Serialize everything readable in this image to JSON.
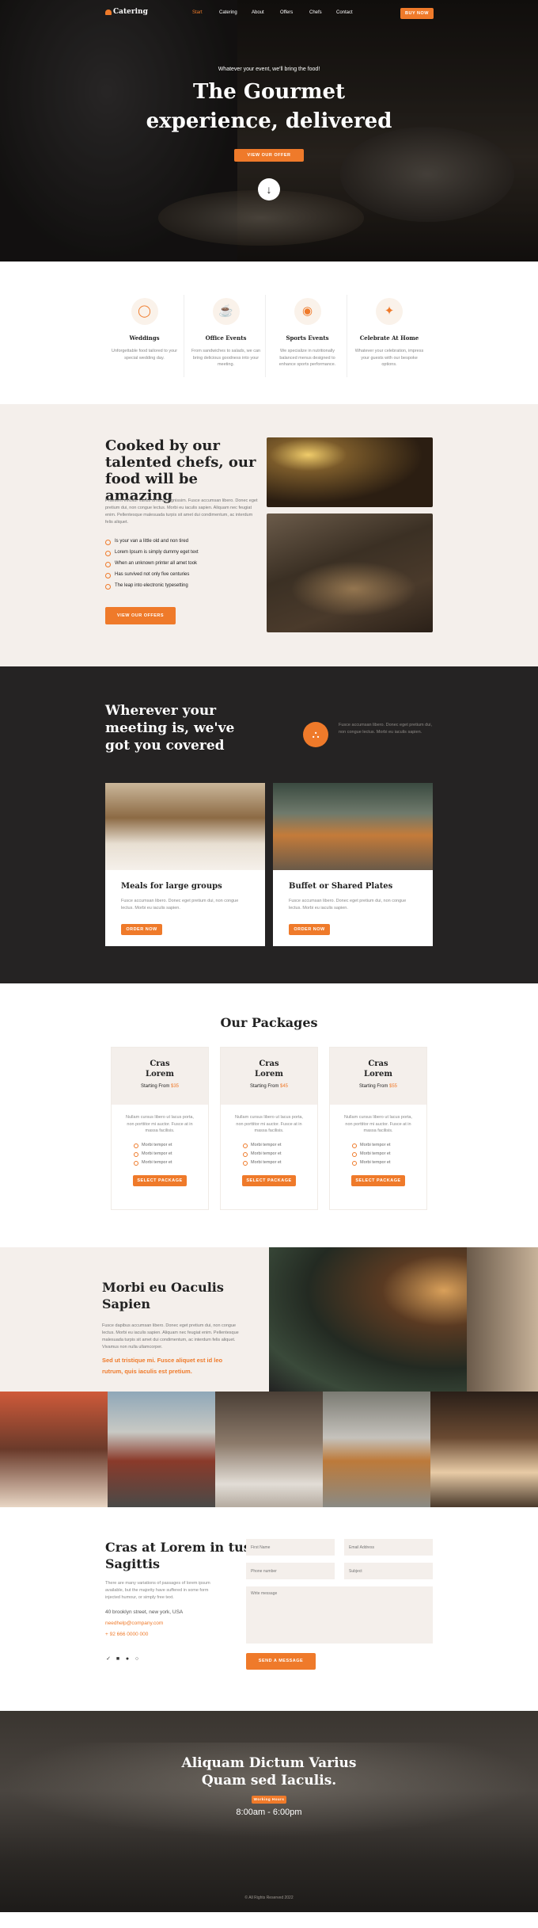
{
  "nav": {
    "logo": "Catering",
    "links": [
      "Start",
      "Catering",
      "About",
      "Offers",
      "Chefs",
      "Contact"
    ],
    "buy": "BUY NOW",
    "accent": "#ef7a2a"
  },
  "hero": {
    "subtitle": "Whatever your event, we'll bring the food!",
    "title_line1": "The Gourmet",
    "title_line2": "experience, delivered",
    "cta": "VIEW OUR OFFER"
  },
  "services": [
    {
      "icon": "ring-icon",
      "title": "Weddings",
      "text": "Unforgettable food tailored to your special wedding day."
    },
    {
      "icon": "cup-icon",
      "title": "Office Events",
      "text": "From sandwiches to salads, we can bring delicious goodness into your meeting."
    },
    {
      "icon": "helmet-icon",
      "title": "Sports Events",
      "text": "We specialize in nutritionally balanced menus designed to enhance sports performance."
    },
    {
      "icon": "celebration-icon",
      "title": "Celebrate At Home",
      "text": "Whatever your celebration, impress your guests with our bespoke options."
    }
  ],
  "cooked": {
    "title": "Cooked by our talented chefs, our food will be amazing",
    "body": "Praesent efficitur varius urna ac dignissim. Fusce accumsan libero. Donec eget pretium dui, non congue lectus. Morbi eu iaculis sapien. Aliquam nec feugiat enim. Pellentesque malesuada turpis sit amet dui condimentum, ac interdum felis aliquet.",
    "list": [
      "Is your van a little old and non tired",
      "Lorem Ipsum is simply dummy eget text",
      "When an unknown printer all amet took",
      "Has survived not only five centuries",
      "The leap into electronic typesetting"
    ],
    "button": "VIEW OUR OFFERS"
  },
  "meeting": {
    "title": "Wherever your meeting is, we've got you covered",
    "text": "Fusce accumsan libero. Donec eget pretium dui, non congue lectus. Morbi eu iaculis sapien.",
    "cards": [
      {
        "title": "Meals for large groups",
        "text": "Fusce accumsan libero. Donec eget pretium dui, non congue lectus. Morbi eu iaculis sapien.",
        "button": "ORDER NOW"
      },
      {
        "title": "Buffet or Shared Plates",
        "text": "Fusce accumsan libero. Donec eget pretium dui, non congue lectus. Morbi eu iaculis sapien.",
        "button": "ORDER NOW"
      }
    ]
  },
  "packages": {
    "title": "Our Packages",
    "items": [
      {
        "name": "Cras Lorem",
        "price_label": "Starting From",
        "price": "$35",
        "desc": "Nullam cursus libero ut lacus porta, non porttitor mi auctor. Fusce at in massa facilisis.",
        "features": [
          "Morbi tempor et",
          "Morbi tempor et",
          "Morbi tempor et"
        ],
        "button": "SELECT PACKAGE"
      },
      {
        "name": "Cras Lorem",
        "price_label": "Starting From",
        "price": "$45",
        "desc": "Nullam cursus libero ut lacus porta, non porttitor mi auctor. Fusce at in massa facilisis.",
        "features": [
          "Morbi tempor et",
          "Morbi tempor et",
          "Morbi tempor et"
        ],
        "button": "SELECT PACKAGE"
      },
      {
        "name": "Cras Lorem",
        "price_label": "Starting From",
        "price": "$55",
        "desc": "Nullam cursus libero ut lacus porta, non porttitor mi auctor. Fusce at in massa facilisis.",
        "features": [
          "Morbi tempor et",
          "Morbi tempor et",
          "Morbi tempor et"
        ],
        "button": "SELECT PACKAGE"
      }
    ]
  },
  "morbi": {
    "title": "Morbi eu Oaculis Sapien",
    "body": "Fusce dapibus accumsan libero. Donec eget pretium dui, non congue lectus. Morbi eu iaculis sapien. Aliquam nec feugiat enim. Pellentesque malesuada turpis sit amet dui condimentum, ac interdum felis aliquet. Vivamus non nulla ullamcorper.",
    "highlight": "Sed ut tristique mi. Fusce aliquet est id leo rutrum, quis iaculis est pretium."
  },
  "contact": {
    "title": "Cras at Lorem in tus Sagittis",
    "body": "There are many variations of passages of lorem ipsum available, but the majority have suffered in some form injected humour, or simply free text.",
    "address": "40 brooklyn street, new york, USA",
    "email": "needhelp@company.com",
    "phone": "+ 92 666 0000 000",
    "fields": {
      "first": "First Name",
      "email": "Email Address",
      "phone": "Phone number",
      "subject": "Subject",
      "message": "Write message"
    },
    "send": "SEND A MESSAGE"
  },
  "hours": {
    "title_line1": "Aliquam Dictum Varius",
    "title_line2": "Quam sed Iaculis.",
    "badge": "Working Hours",
    "time": "8:00am - 6:00pm",
    "footer": "© All Rights Reserved 2022"
  }
}
